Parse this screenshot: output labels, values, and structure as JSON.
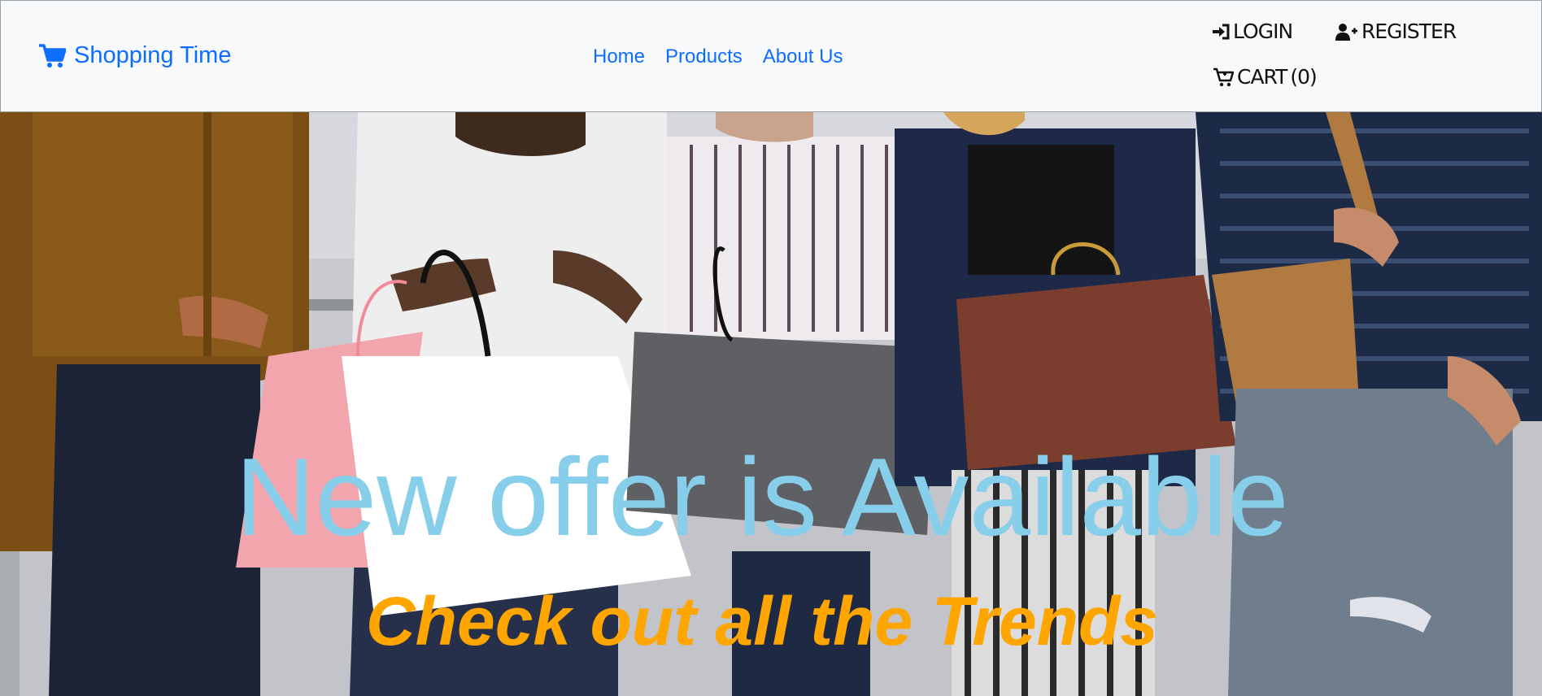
{
  "brand": {
    "name": "Shopping Time",
    "icon": "shopping-cart-icon",
    "color": "#0d6efd"
  },
  "nav": {
    "links": [
      {
        "label": "Home"
      },
      {
        "label": "Products"
      },
      {
        "label": "About Us"
      }
    ],
    "link_color": "#0d6efd"
  },
  "auth": {
    "login_label": "LOGIN",
    "login_icon": "sign-in-arrow-icon",
    "register_label": "REGISTER",
    "register_icon": "user-plus-icon",
    "cart_label": "CART",
    "cart_count": "(0)",
    "cart_icon": "cart-icon"
  },
  "hero": {
    "headline": "New offer is Available",
    "headline_color": "#87ceeb",
    "subline": "Check out all the Trends",
    "subline_color": "#ffa500",
    "image": "shoppers-with-bags-photo"
  },
  "colors": {
    "navbar_bg": "#f8f9fa"
  }
}
